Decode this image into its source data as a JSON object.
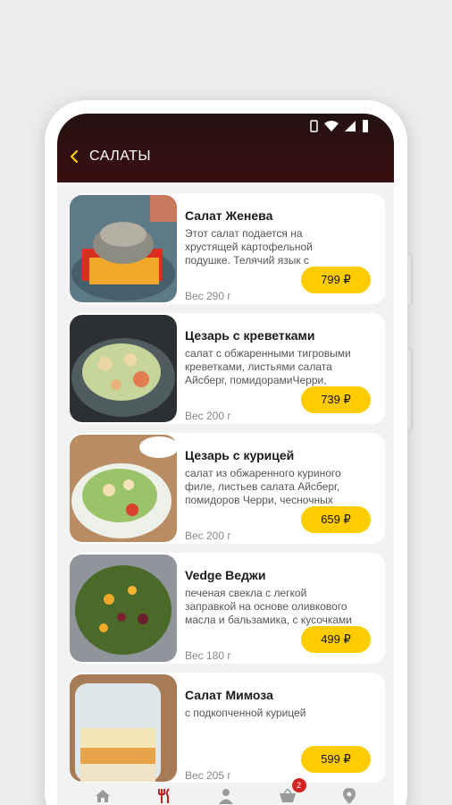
{
  "header": {
    "title": "САЛАТЫ"
  },
  "colors": {
    "accent": "#ffcc00",
    "header": "#2e1010",
    "badge": "#d32222",
    "active_nav": "#c0201c"
  },
  "items": [
    {
      "name": "Салат Женева",
      "desc": "Этот  салат подается на хрустящей картофельной подушке. Телячий язык с",
      "weight": "Вес 290 г",
      "price": "799 ₽"
    },
    {
      "name": "Цезарь с креветками",
      "desc": "салат с обжаренными тигровыми креветками, листьями салата Айсберг, помидорамиЧерри,",
      "weight": "Вес 200 г",
      "price": "739 ₽"
    },
    {
      "name": "Цезарь с курицей",
      "desc": "салат из обжаренного куриного филе, листьев салата Айсберг, помидоров Черри, чесночных",
      "weight": "Вес 200 г",
      "price": "659 ₽"
    },
    {
      "name": "Vedge Веджи",
      "desc": "печеная свекла с легкой заправкой на основе оливкового масла и бальзамика, с кусочками",
      "weight": "Вес 180 г",
      "price": "499 ₽"
    },
    {
      "name": "Салат Мимоза",
      "desc": "с подкопченной курицей",
      "weight": "Вес 205 г",
      "price": "599 ₽"
    }
  ],
  "nav": {
    "items": [
      {
        "icon": "home-icon"
      },
      {
        "icon": "menu-fork-knife-icon",
        "active": true
      },
      {
        "icon": "profile-icon"
      },
      {
        "icon": "cart-icon",
        "badge": "2"
      },
      {
        "icon": "location-pin-icon"
      }
    ]
  }
}
